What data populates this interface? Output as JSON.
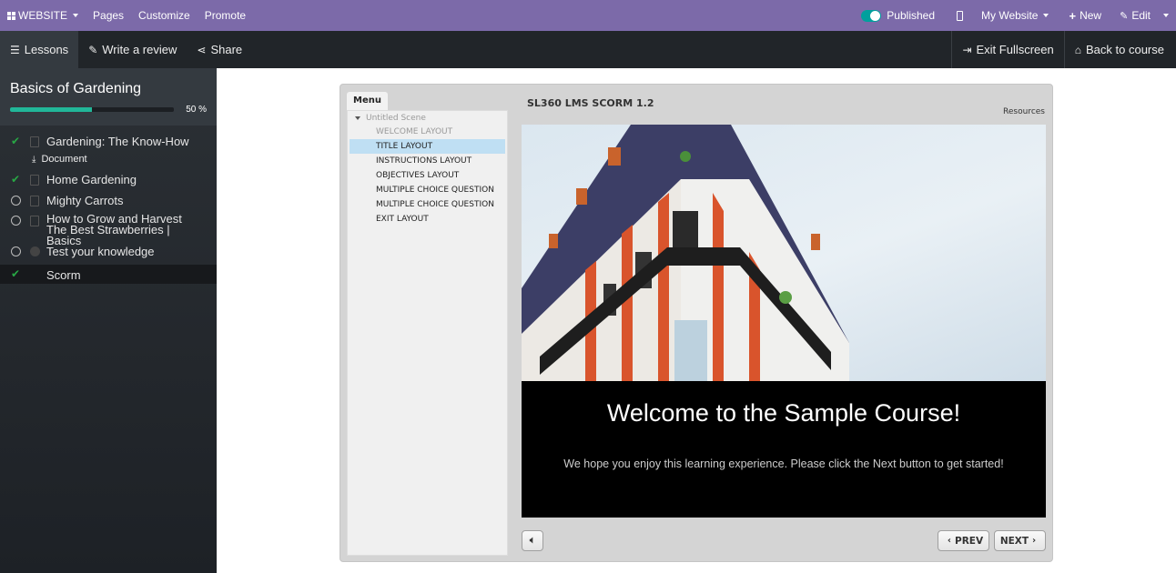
{
  "topbar": {
    "website_label": "WEBSITE",
    "pages": "Pages",
    "customize": "Customize",
    "promote": "Promote",
    "published": "Published",
    "my_website": "My Website",
    "new": "New",
    "edit": "Edit"
  },
  "navbar": {
    "lessons": "Lessons",
    "write_review": "Write a review",
    "share": "Share",
    "exit_fullscreen": "Exit Fullscreen",
    "back_to_course": "Back to course"
  },
  "course": {
    "title": "Basics of Gardening",
    "progress_percent": 50,
    "progress_label": "50 %"
  },
  "lessons": [
    {
      "title": "Gardening: The Know-How",
      "completed": true,
      "type": "document"
    },
    {
      "title": "Home Gardening",
      "completed": true,
      "type": "document"
    },
    {
      "title": "Mighty Carrots",
      "completed": false,
      "type": "document"
    },
    {
      "title": "How to Grow and Harvest The Best Strawberries | Basics",
      "completed": false,
      "type": "document"
    },
    {
      "title": "Test your knowledge",
      "completed": false,
      "type": "quiz"
    },
    {
      "title": "Scorm",
      "completed": true,
      "type": "scorm"
    }
  ],
  "lesson_sub": {
    "document": "Document"
  },
  "player": {
    "menu_tab": "Menu",
    "scene": "Untitled Scene",
    "slides": [
      "WELCOME LAYOUT",
      "TITLE LAYOUT",
      "INSTRUCTIONS LAYOUT",
      "OBJECTIVES LAYOUT",
      "MULTIPLE CHOICE QUESTION",
      "MULTIPLE CHOICE QUESTION",
      "EXIT LAYOUT"
    ],
    "title": "SL360 LMS SCORM 1.2",
    "resources": "Resources",
    "welcome": "Welcome to the Sample Course!",
    "subtext": "We hope you enjoy this learning experience. Please click the Next button to get started!",
    "prev": "PREV",
    "next": "NEXT"
  },
  "colors": {
    "topbar": "#7c6aa9",
    "navbar": "#212529",
    "accent": "#21b799",
    "done": "#28a745"
  },
  "icons": [
    "apps-icon",
    "mobile-icon",
    "plus-icon",
    "pencil-icon",
    "list-icon",
    "share-icon",
    "exit-icon",
    "home-icon",
    "check-icon",
    "download-icon",
    "volume-icon"
  ]
}
